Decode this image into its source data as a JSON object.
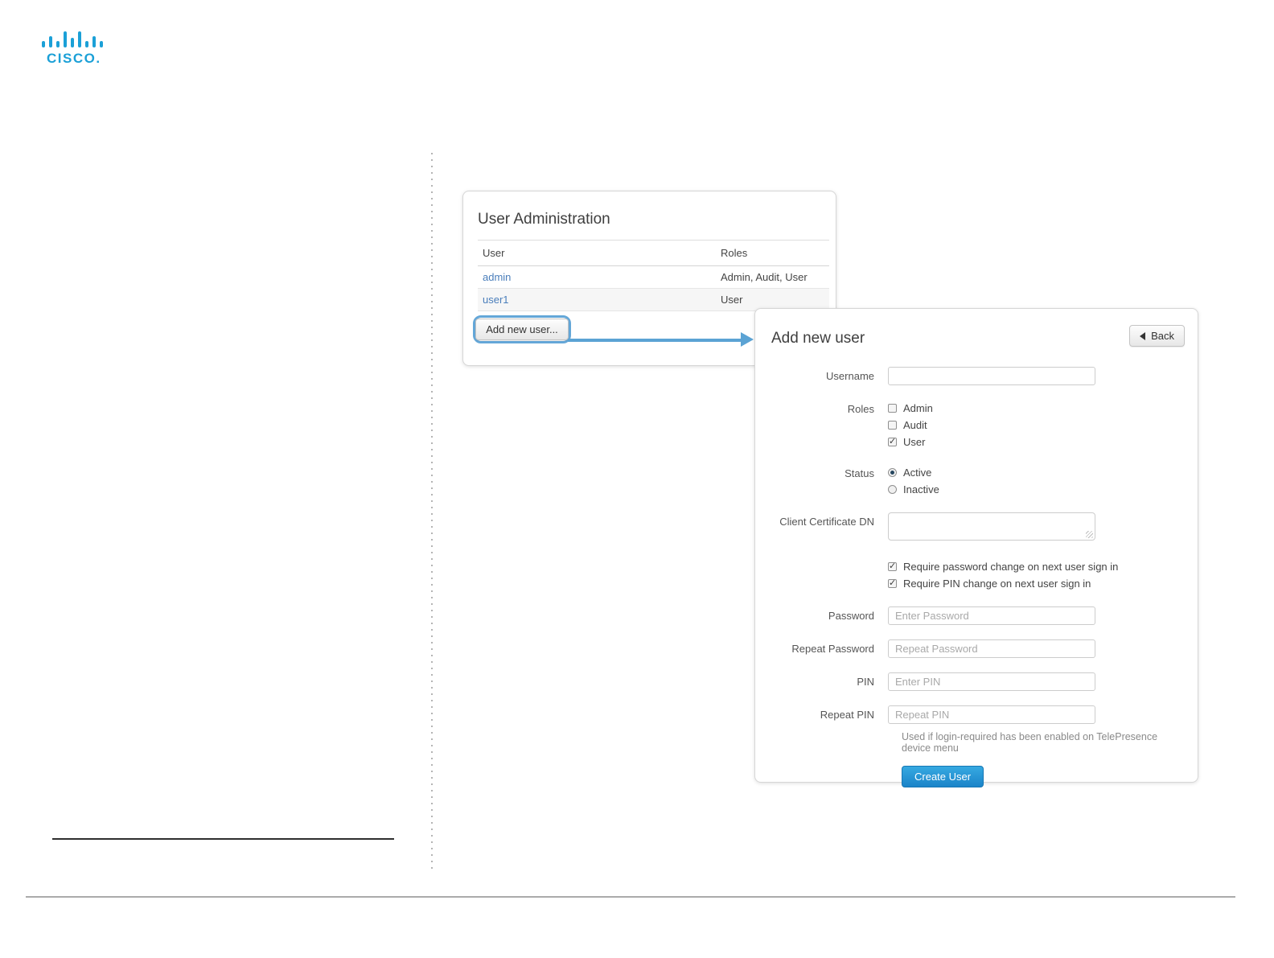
{
  "logo": {
    "brand": "cisco"
  },
  "colors": {
    "cisco_blue": "#1ba0d7",
    "link_blue": "#4a7ebb",
    "callout_arrow_blue": "#5ba3d4",
    "primary_button_blue": "#2196d3"
  },
  "user_admin": {
    "title": "User Administration",
    "table": {
      "columns": [
        "User",
        "Roles"
      ],
      "rows": [
        {
          "user": "admin",
          "roles": "Admin, Audit, User"
        },
        {
          "user": "user1",
          "roles": "User"
        }
      ]
    },
    "add_button_label": "Add new user..."
  },
  "add_user": {
    "title": "Add new user",
    "back_label": "Back",
    "username_label": "Username",
    "username_value": "",
    "roles_label": "Roles",
    "roles": [
      {
        "label": "Admin",
        "checked": false
      },
      {
        "label": "Audit",
        "checked": false
      },
      {
        "label": "User",
        "checked": true
      }
    ],
    "status_label": "Status",
    "status_options": [
      {
        "label": "Active",
        "selected": true
      },
      {
        "label": "Inactive",
        "selected": false
      }
    ],
    "client_cert_label": "Client Certificate DN",
    "client_cert_value": "",
    "require_checks": [
      {
        "label": "Require password change on next user sign in",
        "checked": true
      },
      {
        "label": "Require PIN change on next user sign in",
        "checked": true
      }
    ],
    "password_label": "Password",
    "password_placeholder": "Enter Password",
    "repeat_password_label": "Repeat Password",
    "repeat_password_placeholder": "Repeat Password",
    "pin_label": "PIN",
    "pin_placeholder": "Enter PIN",
    "repeat_pin_label": "Repeat PIN",
    "repeat_pin_placeholder": "Repeat PIN",
    "note": "Used if login-required has been enabled on TelePresence device menu",
    "submit_label": "Create User"
  }
}
